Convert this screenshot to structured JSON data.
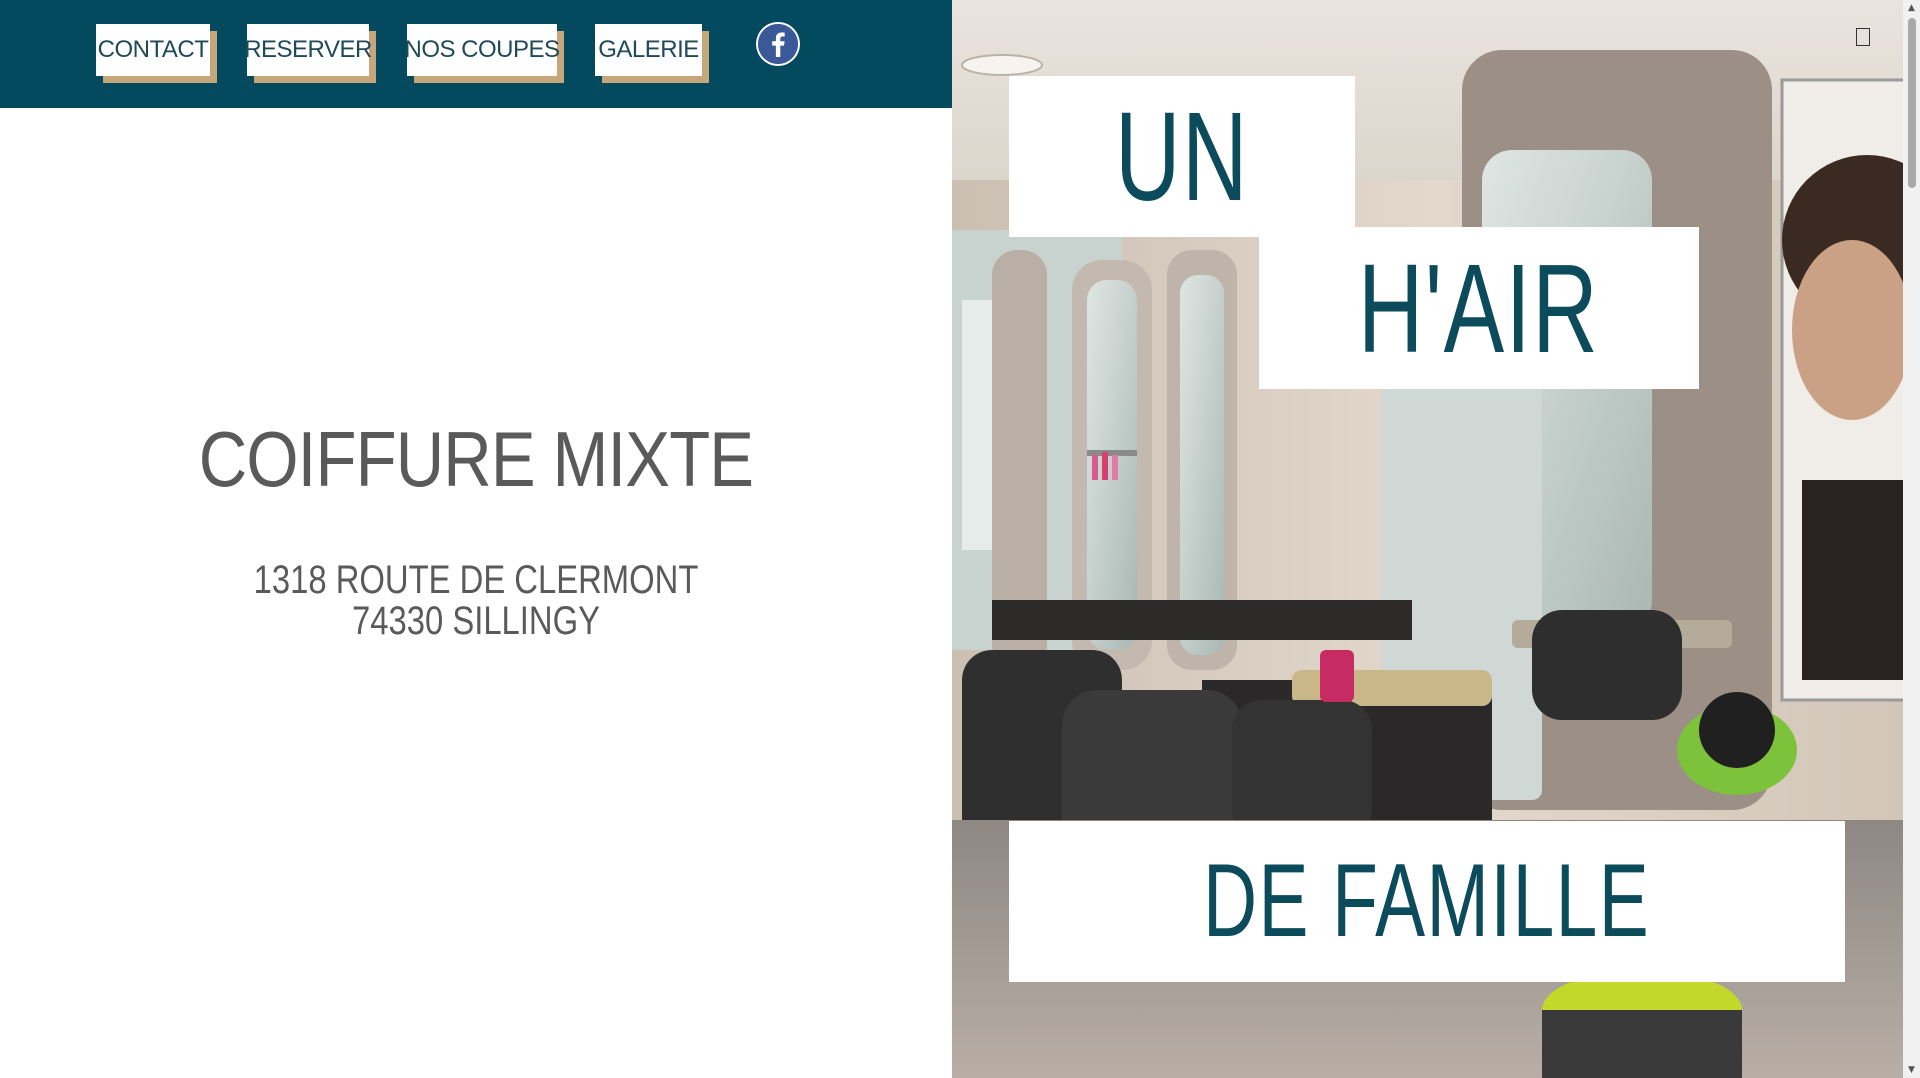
{
  "nav": {
    "contact": "CONTACT",
    "reserver": "RESERVER",
    "nos_coupes": "NOS COUPES",
    "galerie": "GALERIE",
    "facebook_icon": "facebook-icon"
  },
  "hero": {
    "headline": "COIFFURE MIXTE",
    "address_line1": "1318 ROUTE DE CLERMONT",
    "address_line2": "74330 SILLINGY"
  },
  "title": {
    "line1": "UN",
    "line2": "H'AIR",
    "line3": "DE FAMILLE"
  },
  "colors": {
    "header_bg": "#034a5f",
    "button_shadow": "#c7a67c",
    "title_text": "#0b4b5c",
    "body_text": "#5a5a5a",
    "facebook": "#3b5998"
  },
  "scrollbar": {
    "up_arrow": "▲",
    "down_arrow": "▼"
  }
}
